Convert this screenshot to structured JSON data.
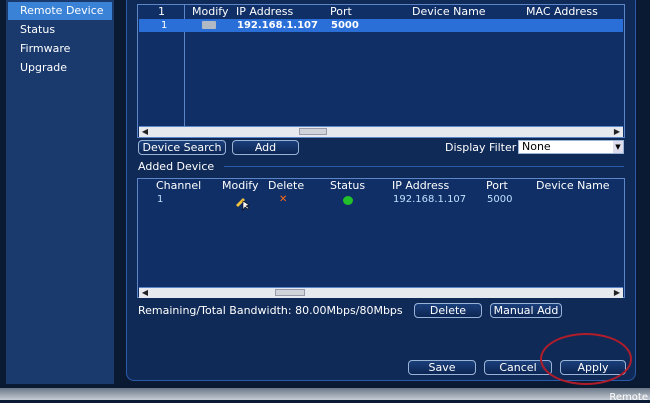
{
  "sidebar": {
    "items": [
      {
        "label": "Remote Device",
        "active": true
      },
      {
        "label": "Status"
      },
      {
        "label": "Firmware"
      },
      {
        "label": "Upgrade"
      }
    ]
  },
  "search_table": {
    "headers": [
      "1",
      "Modify",
      "IP Address",
      "Port",
      "Device Name",
      "MAC Address"
    ],
    "rows": [
      {
        "num": "1",
        "ip": "192.168.1.107",
        "port": "5000",
        "device_name": "",
        "mac": ""
      }
    ]
  },
  "buttons": {
    "device_search": "Device Search",
    "add": "Add",
    "delete": "Delete",
    "manual_add": "Manual Add",
    "save": "Save",
    "cancel": "Cancel",
    "apply": "Apply"
  },
  "display_filter": {
    "label": "Display Filter",
    "value": "None"
  },
  "added_device": {
    "title": "Added Device",
    "headers": [
      "Channel",
      "Modify",
      "Delete",
      "Status",
      "IP Address",
      "Port",
      "Device Name"
    ],
    "rows": [
      {
        "channel": "1",
        "ip": "192.168.1.107",
        "port": "5000",
        "status": "online"
      }
    ]
  },
  "bandwidth": {
    "text": "Remaining/Total Bandwidth: 80.00Mbps/80Mbps"
  },
  "footer": {
    "text": "Remote"
  },
  "colors": {
    "selected_row": "#2a6ed8",
    "online": "#22c02a",
    "delete_x": "#ff6a1a",
    "highlight_ring": "#b01d2a"
  }
}
